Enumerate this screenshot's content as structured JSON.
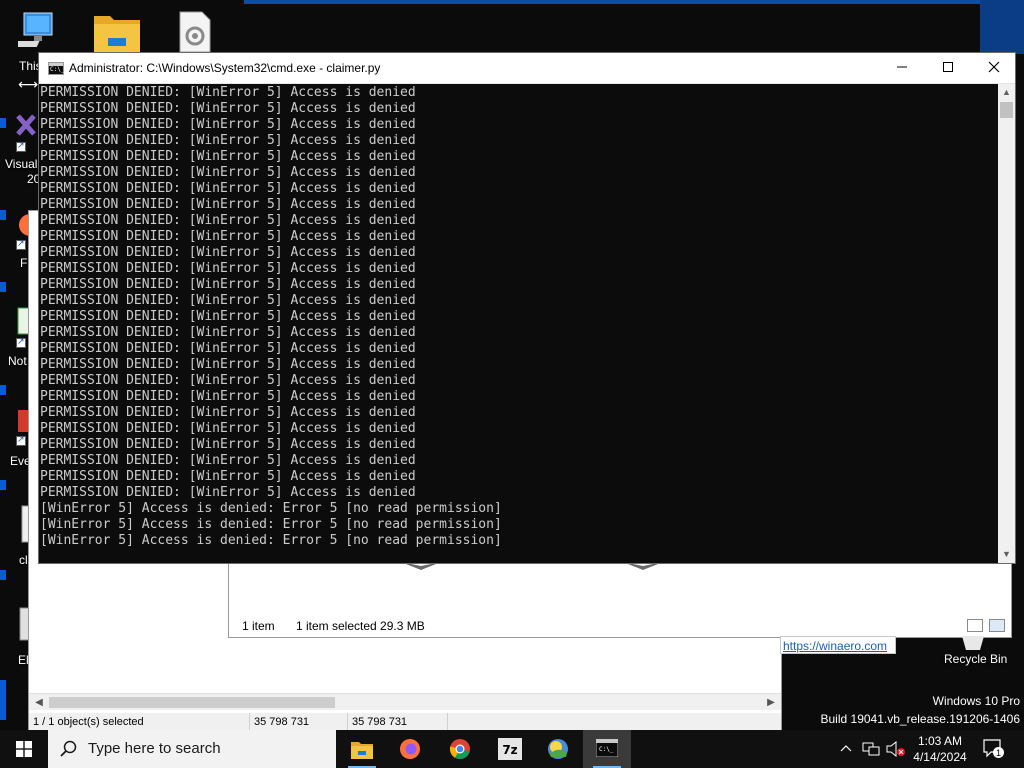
{
  "desktop": {
    "icons": [
      {
        "label": "This"
      },
      {
        "label": "Visual"
      },
      {
        "label": "20"
      },
      {
        "label": "F"
      },
      {
        "label": "Not"
      },
      {
        "label": "Eve"
      },
      {
        "label": "cl"
      },
      {
        "label": "El"
      }
    ],
    "recycle_bin": "Recycle Bin",
    "watermark": {
      "line1": "Windows 10 Pro",
      "line2": "Build 19041.vb_release.191206-1406"
    },
    "link": "https://winaero.com"
  },
  "explorer_back": {
    "status": {
      "selected": "1 / 1 object(s) selected",
      "size1": "35 798 731",
      "size2": "35 798 731"
    }
  },
  "explorer_front": {
    "status": {
      "items": "1 item",
      "selected": "1 item selected  29.3 MB"
    }
  },
  "cmd": {
    "title": "Administrator: C:\\Windows\\System32\\cmd.exe - claimer.py",
    "lines": [
      "PERMISSION DENIED: [WinError 5] Access is denied",
      "PERMISSION DENIED: [WinError 5] Access is denied",
      "PERMISSION DENIED: [WinError 5] Access is denied",
      "PERMISSION DENIED: [WinError 5] Access is denied",
      "PERMISSION DENIED: [WinError 5] Access is denied",
      "PERMISSION DENIED: [WinError 5] Access is denied",
      "PERMISSION DENIED: [WinError 5] Access is denied",
      "PERMISSION DENIED: [WinError 5] Access is denied",
      "PERMISSION DENIED: [WinError 5] Access is denied",
      "PERMISSION DENIED: [WinError 5] Access is denied",
      "PERMISSION DENIED: [WinError 5] Access is denied",
      "PERMISSION DENIED: [WinError 5] Access is denied",
      "PERMISSION DENIED: [WinError 5] Access is denied",
      "PERMISSION DENIED: [WinError 5] Access is denied",
      "PERMISSION DENIED: [WinError 5] Access is denied",
      "PERMISSION DENIED: [WinError 5] Access is denied",
      "PERMISSION DENIED: [WinError 5] Access is denied",
      "PERMISSION DENIED: [WinError 5] Access is denied",
      "PERMISSION DENIED: [WinError 5] Access is denied",
      "PERMISSION DENIED: [WinError 5] Access is denied",
      "PERMISSION DENIED: [WinError 5] Access is denied",
      "PERMISSION DENIED: [WinError 5] Access is denied",
      "PERMISSION DENIED: [WinError 5] Access is denied",
      "PERMISSION DENIED: [WinError 5] Access is denied",
      "PERMISSION DENIED: [WinError 5] Access is denied",
      "PERMISSION DENIED: [WinError 5] Access is denied",
      "[WinError 5] Access is denied: Error 5 [no read permission]",
      "[WinError 5] Access is denied: Error 5 [no read permission]",
      "[WinError 5] Access is denied: Error 5 [no read permission]"
    ]
  },
  "taskbar": {
    "search_placeholder": "Type here to search",
    "apps": [
      "file-explorer",
      "firefox",
      "chrome",
      "7zip",
      "photos",
      "command-prompt"
    ],
    "clock": {
      "time": "1:03 AM",
      "date": "4/14/2024"
    },
    "notification_count": "1"
  },
  "colors": {
    "accent": "#0078d7",
    "console_bg": "#0c0c0c",
    "console_fg": "#cccccc",
    "link": "#1a5fb4"
  }
}
